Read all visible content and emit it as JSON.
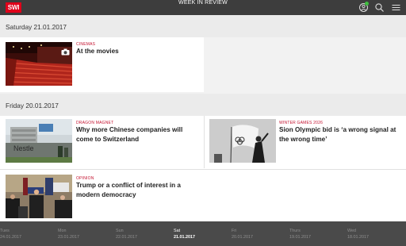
{
  "header": {
    "logo": "SWI",
    "title": "WEEK IN REVIEW",
    "icons": [
      "profile-icon",
      "search-icon",
      "menu-icon"
    ]
  },
  "sections": [
    {
      "date": "Saturday 21.01.2017",
      "articles": [
        {
          "kicker": "CINEMAS",
          "headline": "At the movies",
          "has_camera": true
        }
      ]
    },
    {
      "date": "Friday 20.01.2017",
      "articles": [
        {
          "kicker": "DRAGON MAGNET",
          "headline": "Why more Chinese companies will come to Switzerland"
        },
        {
          "kicker": "WINTER GAMES 2026",
          "headline": "Sion Olympic bid is ‘a wrong signal at the wrong time’"
        },
        {
          "kicker": "OPINION",
          "headline": "Trump or a conflict of interest in a modern democracy"
        }
      ]
    }
  ],
  "days": [
    {
      "name": "Tues",
      "date": "24.01.2017"
    },
    {
      "name": "Mon",
      "date": "23.01.2017"
    },
    {
      "name": "Sun",
      "date": "22.01.2017"
    },
    {
      "name": "Sat",
      "date": "21.01.2017",
      "active": true
    },
    {
      "name": "Fri",
      "date": "20.01.2017"
    },
    {
      "name": "Thurs",
      "date": "19.01.2017"
    },
    {
      "name": "Wed",
      "date": "18.01.2017"
    }
  ],
  "colors": {
    "brand": "#e0001a",
    "kicker": "#c4122f",
    "topbar": "#3d3d3d",
    "bottombar": "#4a4a4a"
  }
}
